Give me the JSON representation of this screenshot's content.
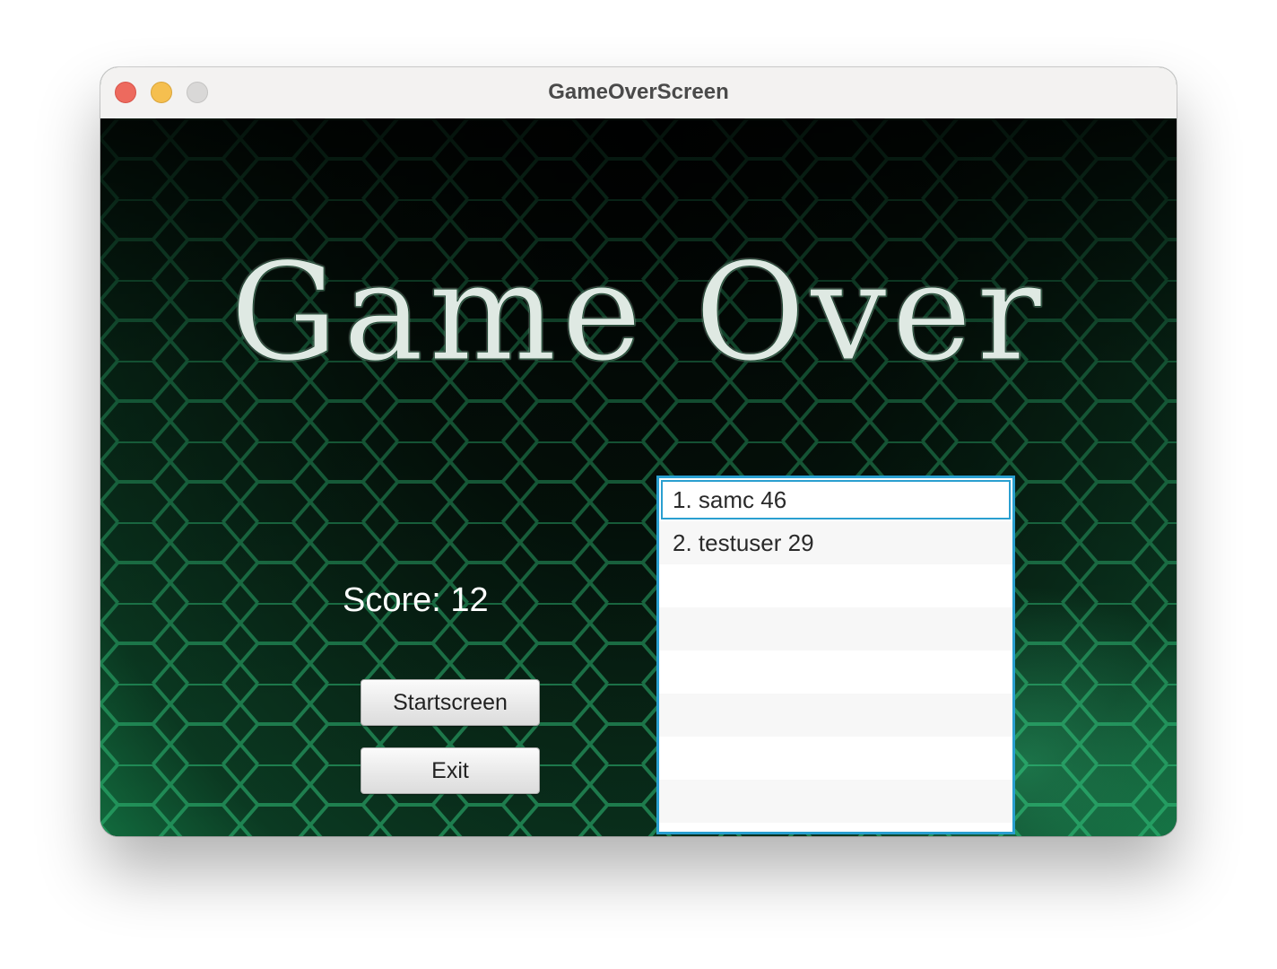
{
  "window": {
    "title": "GameOverScreen"
  },
  "main": {
    "heading": "Game Over",
    "score_text": "Score: 12",
    "buttons": {
      "startscreen_label": "Startscreen",
      "exit_label": "Exit"
    },
    "leaderboard": {
      "entries": [
        "1. samc 46",
        "2. testuser 29",
        "",
        "",
        "",
        "",
        "",
        ""
      ],
      "selected_index": 0
    }
  },
  "colors": {
    "accent_focus": "#2a9fd0",
    "background_green": "#126b3e",
    "close": "#ed6a5e",
    "minimize": "#f5bf4f",
    "zoom": "#d9d8d7"
  }
}
